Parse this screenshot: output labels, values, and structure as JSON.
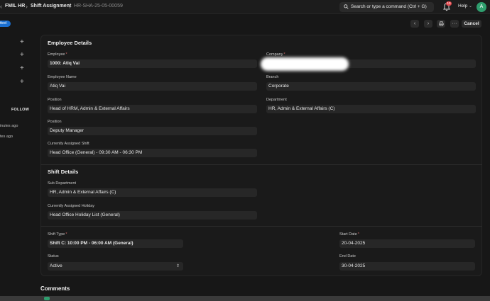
{
  "navbar": {
    "breadcrumbs": [
      "FMIL HR",
      "Shift Assignment",
      "HR-SHA-25-05-00059"
    ],
    "search_placeholder": "Search or type a command (Ctrl + G)",
    "notification_count": "10",
    "help_label": "Help",
    "avatar_initial": "A"
  },
  "page_head": {
    "status": "tted",
    "cancel_label": "Cancel"
  },
  "sidebar": {
    "follow_label": "FOLLOW",
    "activity": [
      "inutes ago",
      "tes ago"
    ]
  },
  "employee_details": {
    "title": "Employee Details",
    "employee": {
      "label": "Employee",
      "value": "1000: Atiq Vai"
    },
    "company": {
      "label": "Company",
      "value": ""
    },
    "employee_name": {
      "label": "Employee Name",
      "value": "Atiq Vai"
    },
    "branch": {
      "label": "Branch",
      "value": "Corporate"
    },
    "position1": {
      "label": "Position",
      "value": "Head of HRM, Admin & External Affairs"
    },
    "department": {
      "label": "Department",
      "value": "HR, Admin & External Affairs (C)"
    },
    "position2": {
      "label": "Position",
      "value": "Deputy Manager"
    },
    "current_shift": {
      "label": "Currently Assigned Shift",
      "value": "Head Office (General) - 09:30 AM - 06:30 PM"
    }
  },
  "shift_details": {
    "title": "Shift Details",
    "sub_department": {
      "label": "Sub Department",
      "value": "HR, Admin & External Affairs (C)"
    },
    "current_holiday": {
      "label": "Currently Assigned Holiday",
      "value": "Head Office Holiday List (General)"
    }
  },
  "assignment": {
    "shift_type": {
      "label": "Shift Type",
      "value": "Shift C: 10:00 PM - 06:00 AM (General)"
    },
    "start_date": {
      "label": "Start Date",
      "value": "20-04-2025"
    },
    "status": {
      "label": "Status",
      "value": "Active"
    },
    "end_date": {
      "label": "End Date",
      "value": "30-04-2025"
    }
  },
  "comments_title": "Comments",
  "colors": {
    "background": "#171717",
    "field": "#272727",
    "status_pill": "#1a6fd1",
    "avatar": "#2f9e6e",
    "badge": "#e5484d",
    "required": "#d06b6b"
  }
}
